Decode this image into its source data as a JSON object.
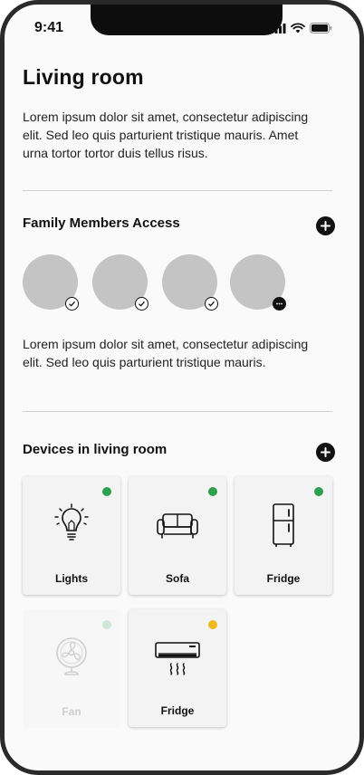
{
  "status": {
    "time": "9:41"
  },
  "page": {
    "title": "Living room",
    "description": "Lorem ipsum dolor sit amet, consectetur adipiscing elit. Sed leo quis parturient tristique mauris. Amet urna tortor tortor duis tellus risus."
  },
  "family": {
    "title": "Family Members Access",
    "members": [
      {
        "status": "check-icon"
      },
      {
        "status": "check-icon"
      },
      {
        "status": "check-icon"
      },
      {
        "status": "more-icon"
      }
    ],
    "description": "Lorem ipsum dolor sit amet, consectetur adipiscing elit. Sed leo quis parturient tristique mauris."
  },
  "devices": {
    "title": "Devices in living room",
    "items": [
      {
        "label": "Lights",
        "icon": "lightbulb-icon",
        "status_color": "#2e9e4f"
      },
      {
        "label": "Sofa",
        "icon": "sofa-icon",
        "status_color": "#2e9e4f"
      },
      {
        "label": "Fridge",
        "icon": "fridge-icon",
        "status_color": "#2e9e4f"
      },
      {
        "label": "Fan",
        "icon": "fan-icon",
        "status_color": "#cfe8d6"
      },
      {
        "label": "Fridge",
        "icon": "air-conditioner-icon",
        "status_color": "#f0b91c"
      }
    ]
  },
  "colors": {
    "accent": "#111111",
    "on": "#2e9e4f",
    "standby": "#f0b91c",
    "off": "#cfe8d6"
  }
}
